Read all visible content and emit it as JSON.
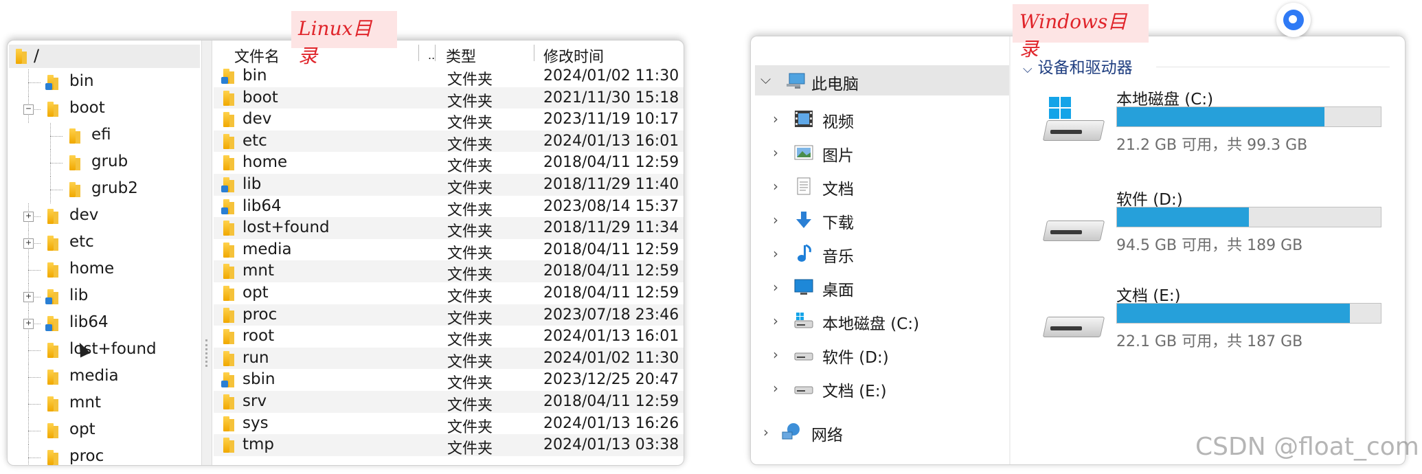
{
  "linux": {
    "tag": "Linux目录",
    "tree": {
      "root": "/",
      "items": [
        {
          "label": "bin",
          "indent": 1,
          "expander": "",
          "link": true
        },
        {
          "label": "boot",
          "indent": 1,
          "expander": "−",
          "link": false
        },
        {
          "label": "efi",
          "indent": 2,
          "expander": "",
          "link": false
        },
        {
          "label": "grub",
          "indent": 2,
          "expander": "",
          "link": false
        },
        {
          "label": "grub2",
          "indent": 2,
          "expander": "",
          "link": false
        },
        {
          "label": "dev",
          "indent": 1,
          "expander": "+",
          "link": false
        },
        {
          "label": "etc",
          "indent": 1,
          "expander": "+",
          "link": false
        },
        {
          "label": "home",
          "indent": 1,
          "expander": "",
          "link": false
        },
        {
          "label": "lib",
          "indent": 1,
          "expander": "+",
          "link": true
        },
        {
          "label": "lib64",
          "indent": 1,
          "expander": "+",
          "link": true
        },
        {
          "label": "lost+found",
          "indent": 1,
          "expander": "",
          "link": false
        },
        {
          "label": "media",
          "indent": 1,
          "expander": "",
          "link": false
        },
        {
          "label": "mnt",
          "indent": 1,
          "expander": "",
          "link": false
        },
        {
          "label": "opt",
          "indent": 1,
          "expander": "",
          "link": false
        },
        {
          "label": "proc",
          "indent": 1,
          "expander": "",
          "link": false
        }
      ]
    },
    "list": {
      "headers": {
        "name": "文件名",
        "sort": "..",
        "type": "类型",
        "modified": "修改时间"
      },
      "rows": [
        {
          "name": "bin",
          "type": "文件夹",
          "date": "2024/01/02 11:30",
          "link": true
        },
        {
          "name": "boot",
          "type": "文件夹",
          "date": "2021/11/30 15:18",
          "link": false
        },
        {
          "name": "dev",
          "type": "文件夹",
          "date": "2023/11/19 10:17",
          "link": false
        },
        {
          "name": "etc",
          "type": "文件夹",
          "date": "2024/01/13 16:01",
          "link": false
        },
        {
          "name": "home",
          "type": "文件夹",
          "date": "2018/04/11 12:59",
          "link": false
        },
        {
          "name": "lib",
          "type": "文件夹",
          "date": "2018/11/29 11:40",
          "link": true
        },
        {
          "name": "lib64",
          "type": "文件夹",
          "date": "2023/08/14 15:37",
          "link": true
        },
        {
          "name": "lost+found",
          "type": "文件夹",
          "date": "2018/11/29 11:34",
          "link": false
        },
        {
          "name": "media",
          "type": "文件夹",
          "date": "2018/04/11 12:59",
          "link": false
        },
        {
          "name": "mnt",
          "type": "文件夹",
          "date": "2018/04/11 12:59",
          "link": false
        },
        {
          "name": "opt",
          "type": "文件夹",
          "date": "2018/04/11 12:59",
          "link": false
        },
        {
          "name": "proc",
          "type": "文件夹",
          "date": "2023/07/18 23:46",
          "link": false
        },
        {
          "name": "root",
          "type": "文件夹",
          "date": "2024/01/13 16:01",
          "link": false
        },
        {
          "name": "run",
          "type": "文件夹",
          "date": "2024/01/02 11:30",
          "link": false
        },
        {
          "name": "sbin",
          "type": "文件夹",
          "date": "2023/12/25 20:47",
          "link": true
        },
        {
          "name": "srv",
          "type": "文件夹",
          "date": "2018/04/11 12:59",
          "link": false
        },
        {
          "name": "sys",
          "type": "文件夹",
          "date": "2024/01/13 16:26",
          "link": false
        },
        {
          "name": "tmp",
          "type": "文件夹",
          "date": "2024/01/13 03:38",
          "link": false
        }
      ]
    }
  },
  "windows": {
    "tag": "Windows目录",
    "nav": {
      "this_pc": "此电脑",
      "items": [
        {
          "label": "视频",
          "icon": "video-icon"
        },
        {
          "label": "图片",
          "icon": "pictures-icon"
        },
        {
          "label": "文档",
          "icon": "documents-icon"
        },
        {
          "label": "下载",
          "icon": "download-icon"
        },
        {
          "label": "音乐",
          "icon": "music-icon"
        },
        {
          "label": "桌面",
          "icon": "desktop-icon"
        },
        {
          "label": "本地磁盘 (C:)",
          "icon": "system-drive-icon"
        },
        {
          "label": "软件 (D:)",
          "icon": "drive-icon"
        },
        {
          "label": "文档 (E:)",
          "icon": "drive-icon"
        }
      ],
      "network": "网络"
    },
    "section": "设备和驱动器",
    "drives": [
      {
        "name": "本地磁盘 (C:)",
        "free": "21.2 GB 可用，共 99.3 GB",
        "used_fraction": 0.787,
        "system": true
      },
      {
        "name": "软件 (D:)",
        "free": "94.5 GB 可用，共 189 GB",
        "used_fraction": 0.5,
        "system": false
      },
      {
        "name": "文档 (E:)",
        "free": "22.1 GB 可用，共 187 GB",
        "used_fraction": 0.882,
        "system": false
      }
    ]
  },
  "watermark": "CSDN @float_com",
  "colors": {
    "accent": "#26a0da",
    "tag_text": "#e0242a",
    "tag_bg": "#fde4e4",
    "section": "#1f3e80"
  }
}
